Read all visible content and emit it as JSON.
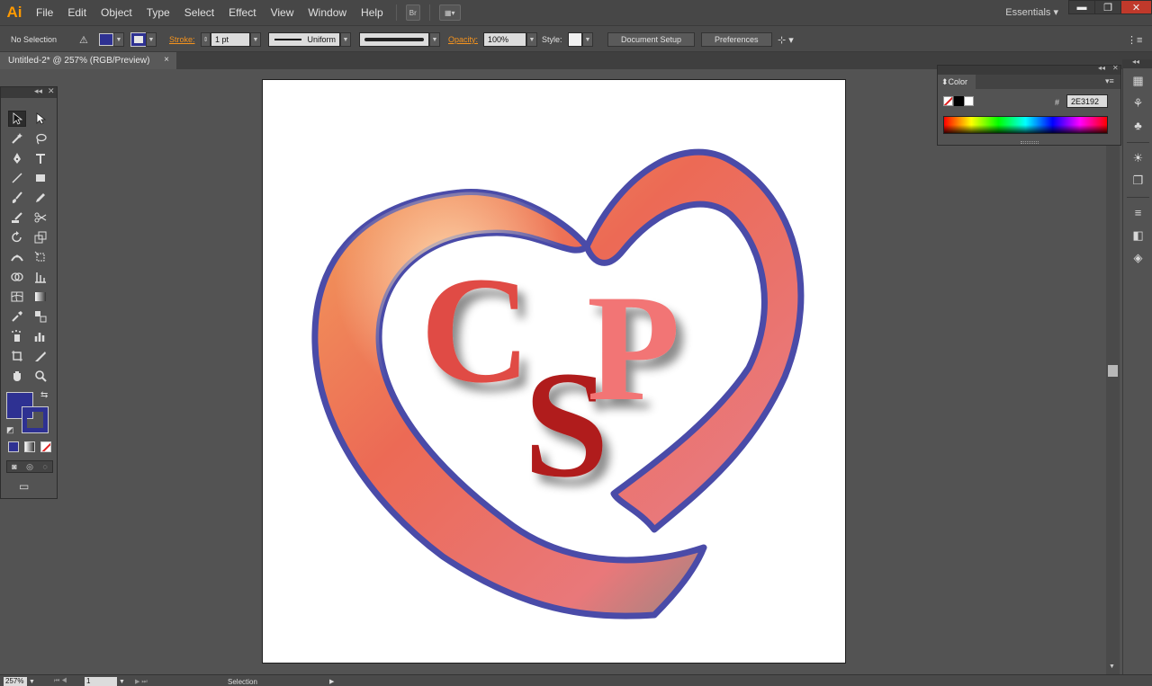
{
  "app": {
    "logo": "Ai"
  },
  "menu": [
    "File",
    "Edit",
    "Object",
    "Type",
    "Select",
    "Effect",
    "View",
    "Window",
    "Help"
  ],
  "menubar_buttons": {
    "bridge": "Br",
    "arrange": "▦▾"
  },
  "workspace": "Essentials",
  "window_controls": {
    "minimize": "▬",
    "restore": "❐",
    "close": "✕"
  },
  "control_bar": {
    "selection": "No Selection",
    "stroke_label": "Stroke:",
    "stroke_weight": "1 pt",
    "profile": "Uniform",
    "opacity_label": "Opacity:",
    "opacity_value": "100%",
    "style_label": "Style:",
    "document_setup": "Document Setup",
    "preferences": "Preferences",
    "fill_color": "#2e3192"
  },
  "document_tab": {
    "title": "Untitled-2* @ 257% (RGB/Preview)",
    "close": "×"
  },
  "color_panel": {
    "title": "Color",
    "hex_label": "#",
    "hex_value": "2E3192"
  },
  "logo_art": {
    "letters": [
      "C",
      "S",
      "P"
    ]
  },
  "status_bar": {
    "zoom": "257%",
    "page": "1",
    "tool": "Selection"
  },
  "colors": {
    "fill": "#2e3192",
    "heart_outline": "#4a4ba8",
    "letter_c": "#e04b44",
    "letter_s": "#b01c1c",
    "letter_p": "#f27575"
  }
}
